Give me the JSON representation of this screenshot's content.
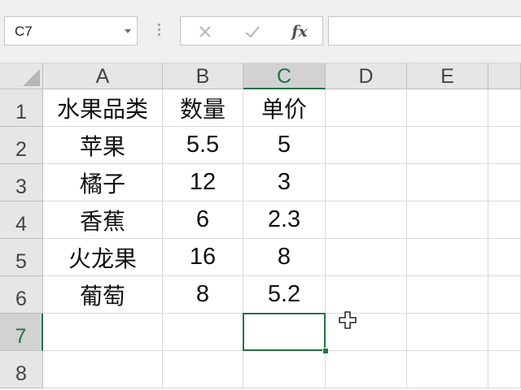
{
  "name_box": {
    "value": "C7"
  },
  "formula_bar": {
    "cancel_icon": "x-icon",
    "enter_icon": "check-icon",
    "insert_function": "fx",
    "formula_value": ""
  },
  "columns": [
    "A",
    "B",
    "C",
    "D",
    "E"
  ],
  "rows": [
    "1",
    "2",
    "3",
    "4",
    "5",
    "6",
    "7",
    "8"
  ],
  "cells": [
    [
      "水果品类",
      "数量",
      "单价",
      "",
      ""
    ],
    [
      "苹果",
      "5.5",
      "5",
      "",
      ""
    ],
    [
      "橘子",
      "12",
      "3",
      "",
      ""
    ],
    [
      "香蕉",
      "6",
      "2.3",
      "",
      ""
    ],
    [
      "火龙果",
      "16",
      "8",
      "",
      ""
    ],
    [
      "葡萄",
      "8",
      "5.2",
      "",
      ""
    ],
    [
      "",
      "",
      "",
      "",
      ""
    ],
    [
      "",
      "",
      "",
      "",
      ""
    ]
  ],
  "selection": {
    "cell": "C7",
    "column": "C",
    "row": "7"
  },
  "colors": {
    "accent": "#217346",
    "header_bg": "#e6e6e6",
    "gridline": "#dadada"
  },
  "cursor_icon": "crosshair-cursor-icon"
}
